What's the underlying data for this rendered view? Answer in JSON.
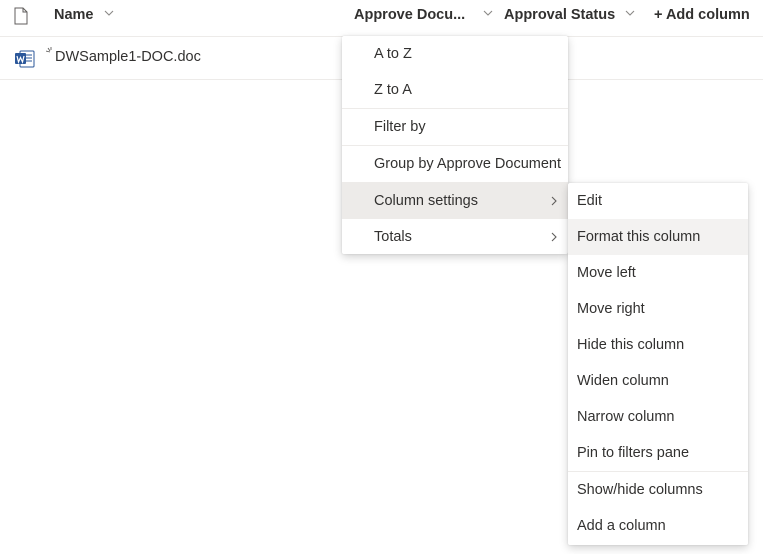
{
  "header": {
    "name_label": "Name",
    "approve_label": "Approve Docu...",
    "status_label": "Approval Status",
    "add_column_label": "+ Add column"
  },
  "row": {
    "file_name": "DWSample1-DOC.doc"
  },
  "column_menu": {
    "items": [
      {
        "label": "A to Z"
      },
      {
        "label": "Z to A"
      },
      {
        "label": "Filter by"
      },
      {
        "label": "Group by Approve Document"
      },
      {
        "label": "Column settings"
      },
      {
        "label": "Totals"
      }
    ]
  },
  "settings_menu": {
    "items": [
      {
        "label": "Edit"
      },
      {
        "label": "Format this column"
      },
      {
        "label": "Move left"
      },
      {
        "label": "Move right"
      },
      {
        "label": "Hide this column"
      },
      {
        "label": "Widen column"
      },
      {
        "label": "Narrow column"
      },
      {
        "label": "Pin to filters pane"
      },
      {
        "label": "Show/hide columns"
      },
      {
        "label": "Add a column"
      }
    ]
  },
  "colors": {
    "word_blue": "#2b579a",
    "hover_bg": "#edebe9",
    "text": "#323130"
  },
  "icons": [
    "document-icon",
    "chevron-down-icon",
    "word-file-icon",
    "chevron-right-icon"
  ]
}
